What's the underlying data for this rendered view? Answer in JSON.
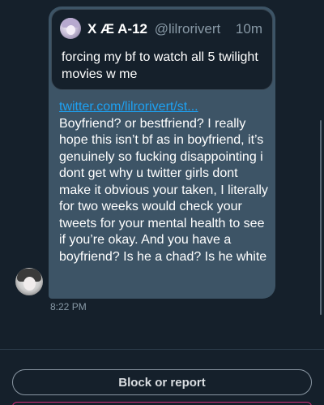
{
  "quoted_tweet": {
    "author_name": "X Æ A-12",
    "author_handle": "@lilrorivert",
    "time": "10m",
    "text": "forcing my bf to watch all 5 twilight movies w me",
    "avatar_icon": "profile-avatar-anime"
  },
  "message": {
    "link_text": "twitter.com/lilrorivert/st...",
    "body": "Boyfriend? or bestfriend? I really hope this isn’t bf as in boyfriend, it’s genuinely so fucking disappointing i dont get why u twitter girls dont make it obvious your taken, I literally for two weeks would check your tweets for your mental health to see if you’re okay. And you have a boyfriend? Is he a chad? Is he white",
    "timestamp": "8:22 PM",
    "sender_avatar_icon": "profile-avatar-anime-bw"
  },
  "actions": {
    "block_label": "Block or report"
  },
  "colors": {
    "background": "#15202b",
    "bubble": "#3d5466",
    "link": "#1da1f2",
    "muted_text": "#8899a6",
    "danger_outline": "#d32c78"
  }
}
